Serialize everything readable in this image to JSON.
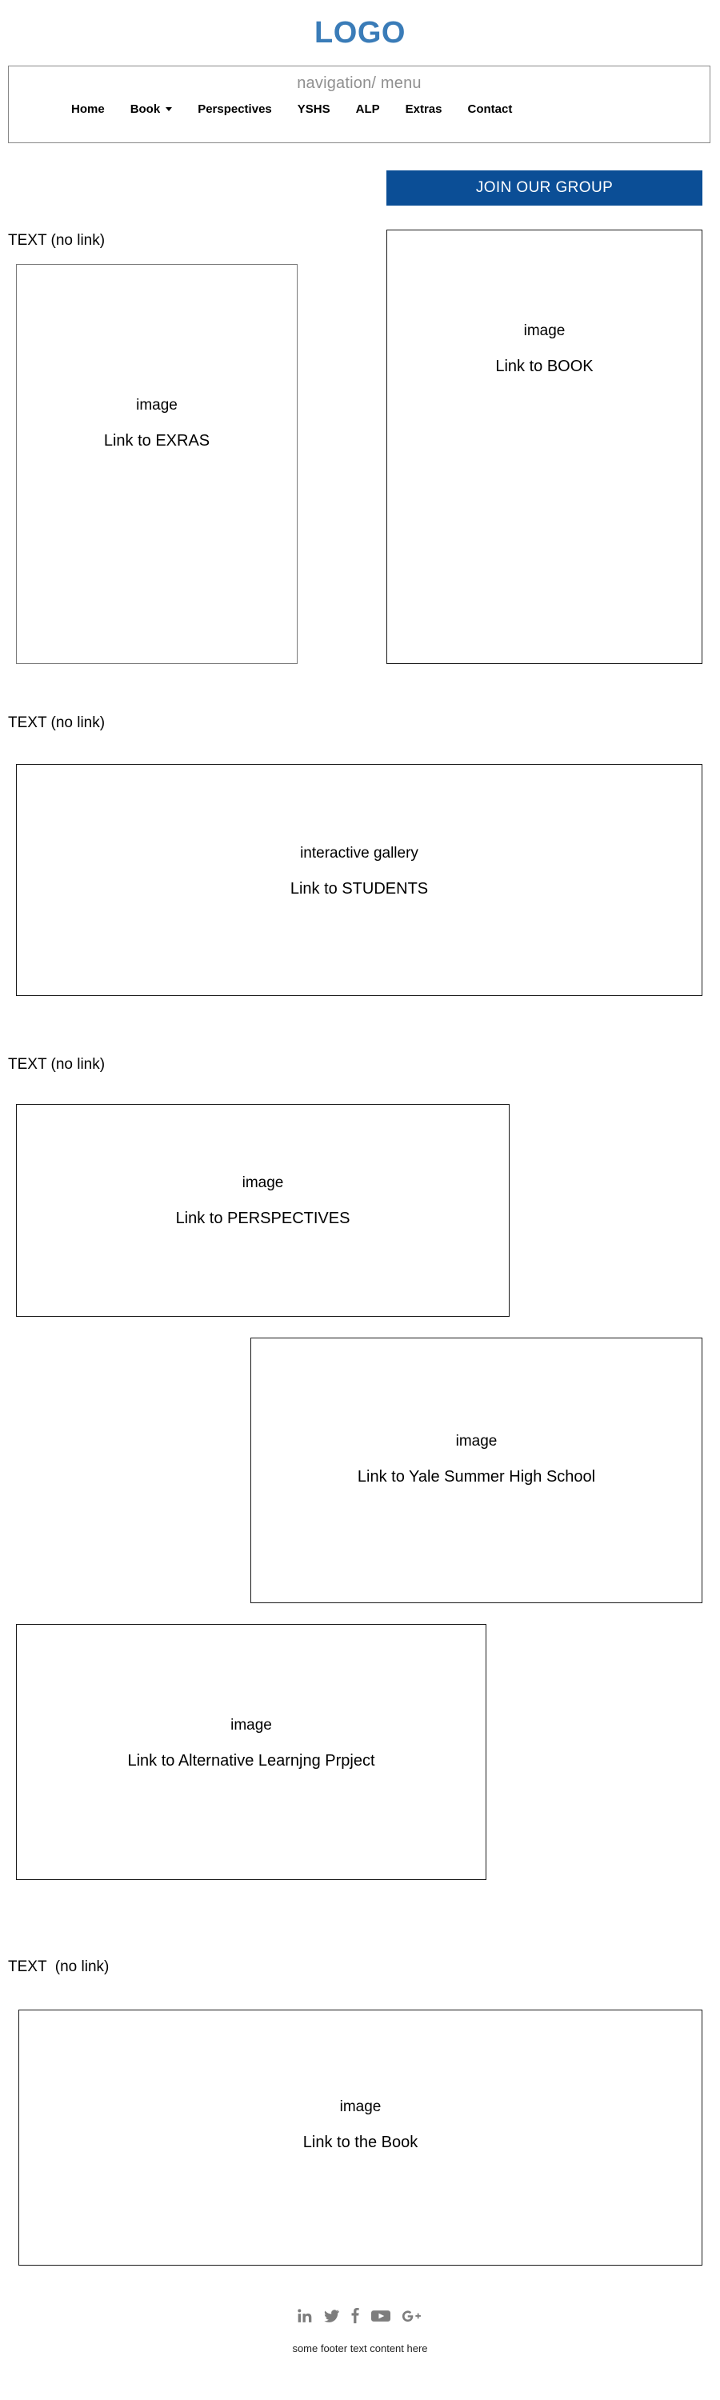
{
  "header": {
    "logo": "LOGO",
    "nav_caption": "navigation/ menu",
    "nav_items": [
      {
        "label": "Home",
        "has_caret": false
      },
      {
        "label": "Book",
        "has_caret": true
      },
      {
        "label": "Perspectives",
        "has_caret": false
      },
      {
        "label": "YSHS",
        "has_caret": false
      },
      {
        "label": "ALP",
        "has_caret": false
      },
      {
        "label": "Extras",
        "has_caret": false
      },
      {
        "label": "Contact",
        "has_caret": false
      }
    ]
  },
  "cta": {
    "join_label": "JOIN OUR GROUP",
    "background_color": "#0b4e96",
    "text_color": "#ffffff"
  },
  "colors": {
    "logo_blue": "#3a7cb8",
    "cta_blue": "#0b4e96",
    "nav_caption_gray": "#909090",
    "box_border": "#1a1a1a",
    "box_border_gray": "#7a7a7a",
    "social_gray": "#7d7d7d"
  },
  "sections": [
    {
      "label": "TEXT (no link)",
      "boxes": [
        {
          "kind": "image",
          "link": "Link to EXRAS"
        },
        {
          "kind": "image",
          "link": "Link to BOOK"
        }
      ]
    },
    {
      "label": "TEXT (no link)",
      "boxes": [
        {
          "kind": "interactive gallery",
          "link": "Link to STUDENTS"
        }
      ]
    },
    {
      "label": "TEXT (no link)",
      "boxes": [
        {
          "kind": "image",
          "link": "Link to PERSPECTIVES"
        },
        {
          "kind": "image",
          "link": "Link to Yale Summer High School"
        },
        {
          "kind": "image",
          "link": "Link to Alternative Learnjng Prpject"
        }
      ]
    },
    {
      "label": "TEXT  (no link)",
      "boxes": [
        {
          "kind": "image",
          "link": "Link to the Book"
        }
      ]
    }
  ],
  "footer": {
    "social": [
      {
        "name": "linkedin-icon",
        "glyph": "in"
      },
      {
        "name": "twitter-icon",
        "glyph": "twitter"
      },
      {
        "name": "facebook-icon",
        "glyph": "f"
      },
      {
        "name": "youtube-icon",
        "glyph": "youtube"
      },
      {
        "name": "googleplus-icon",
        "glyph": "G+"
      }
    ],
    "text": "some footer text content here"
  }
}
